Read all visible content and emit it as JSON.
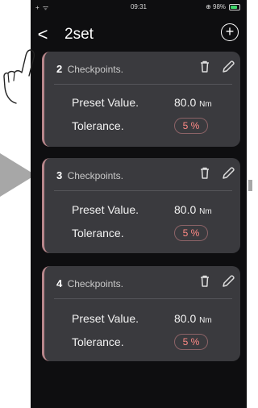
{
  "status": {
    "left": "+ ᯤ",
    "time": "09:31",
    "battery": "⊕ 98%"
  },
  "nav": {
    "back": "<",
    "title": "2set",
    "add": "+"
  },
  "labels": {
    "preset": "Preset Value.",
    "tolerance": "Tolerance."
  },
  "cards": [
    {
      "num": "2",
      "label": "Checkpoints.",
      "value": "80.0",
      "unit": "Nm",
      "tol": "5 %"
    },
    {
      "num": "3",
      "label": "Checkpoints.",
      "value": "80.0",
      "unit": "Nm",
      "tol": "5 %"
    },
    {
      "num": "4",
      "label": "Checkpoints.",
      "value": "80.0",
      "unit": "Nm",
      "tol": "5 %"
    }
  ]
}
